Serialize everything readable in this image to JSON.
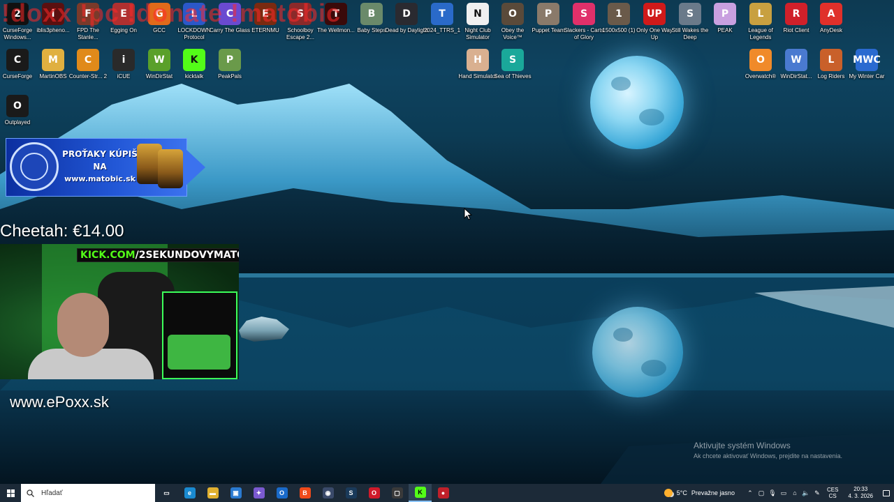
{
  "overlay": {
    "red_text": "!doxx !pc !donate !matobic"
  },
  "desktop_icons": [
    {
      "label": "CurseForge Windows...",
      "glyph": "2",
      "color": "#111111"
    },
    {
      "label": "iblis3pheno...",
      "glyph": "i",
      "color": "#5a1010"
    },
    {
      "label": "FPD The Stanle...",
      "glyph": "F",
      "color": "#7a3a2a"
    },
    {
      "label": "Egging On",
      "glyph": "E",
      "color": "#b03030"
    },
    {
      "label": "GCC",
      "glyph": "G",
      "color": "#e06a1a"
    },
    {
      "label": "LOCKDOWN Protocol",
      "glyph": "L",
      "color": "#2b58c9"
    },
    {
      "label": "Carry The Glass",
      "glyph": "C",
      "color": "#6a4ad0"
    },
    {
      "label": "ETERNMU",
      "glyph": "E",
      "color": "#7a2a10"
    },
    {
      "label": "Schoolboy Escape 2...",
      "glyph": "S",
      "color": "#8b2a2a"
    },
    {
      "label": "The Wellmon...",
      "glyph": "T",
      "color": "#3a0a0a"
    },
    {
      "label": "Baby Steps",
      "glyph": "B",
      "color": "#6a8a6a"
    },
    {
      "label": "Dead by Daylight",
      "glyph": "D",
      "color": "#2a2a30"
    },
    {
      "label": "2024_TTRS_1",
      "glyph": "T",
      "color": "#2a6ac9"
    },
    {
      "label": "Night Club Simulator",
      "glyph": "N",
      "color": "#f0f0f0"
    },
    {
      "label": "Obey the Voice™",
      "glyph": "O",
      "color": "#5a4a3a"
    },
    {
      "label": "Puppet Team",
      "glyph": "P",
      "color": "#8a7a6a"
    },
    {
      "label": "Slackers - Carts of Glory",
      "glyph": "S",
      "color": "#e0306a"
    },
    {
      "label": "1500x500 (1)",
      "glyph": "1",
      "color": "#6a5a4a"
    },
    {
      "label": "Only One Way Up",
      "glyph": "UP",
      "color": "#d01a1a"
    },
    {
      "label": "Still Wakes the Deep",
      "glyph": "S",
      "color": "#6a7a8a"
    },
    {
      "label": "PEAK",
      "glyph": "P",
      "color": "#c9a0e0"
    },
    {
      "label": "League of Legends",
      "glyph": "L",
      "color": "#c8a040"
    },
    {
      "label": "Riot Client",
      "glyph": "R",
      "color": "#d0202a"
    },
    {
      "label": "AnyDesk",
      "glyph": "A",
      "color": "#e0302a"
    },
    {
      "label": "CurseForge",
      "glyph": "C",
      "color": "#1a1a1a"
    },
    {
      "label": "MartinOBS",
      "glyph": "M",
      "color": "#e0b040"
    },
    {
      "label": "Counter-Str... 2",
      "glyph": "C",
      "color": "#e08a1a"
    },
    {
      "label": "iCUE",
      "glyph": "i",
      "color": "#2a2a2a"
    },
    {
      "label": "WinDirStat",
      "glyph": "W",
      "color": "#5aa02a"
    },
    {
      "label": "kicktalk",
      "glyph": "K",
      "color": "#53fc18"
    },
    {
      "label": "PeakPals",
      "glyph": "P",
      "color": "#6a9a4a"
    },
    {
      "label": "Hand Simulator",
      "glyph": "H",
      "color": "#d9b090"
    },
    {
      "label": "Sea of Thieves",
      "glyph": "S",
      "color": "#1aa89a"
    },
    {
      "label": "Overwatch®",
      "glyph": "O",
      "color": "#f08a2a"
    },
    {
      "label": "WinDirStat...",
      "glyph": "W",
      "color": "#4a7ad0"
    },
    {
      "label": "Log Riders",
      "glyph": "L",
      "color": "#c9602a"
    },
    {
      "label": "My Winter Car",
      "glyph": "MWC",
      "color": "#2a6ad0"
    },
    {
      "label": "Outplayed",
      "glyph": "O",
      "color": "#1a1a1a"
    }
  ],
  "promo": {
    "line1": "PROŤAKY KÚPIŠ",
    "line2": "NA",
    "line3": "www.matobic.sk"
  },
  "stream": {
    "donation": "Cheetah: €14.00",
    "kick_prefix": "KICK.COM",
    "kick_suffix": "/2SEKUNDOVYMATO",
    "website": "www.ePoxx.sk"
  },
  "activation": {
    "title": "Aktivujte systém Windows",
    "subtitle": "Ak chcete aktivovať Windows, prejdite na nastavenia."
  },
  "taskbar": {
    "search_placeholder": "Hľadať",
    "pinned": [
      {
        "name": "task-view-icon",
        "glyph": "▭",
        "color": "transparent"
      },
      {
        "name": "edge-icon",
        "glyph": "e",
        "color": "#1a8ad0"
      },
      {
        "name": "file-explorer-icon",
        "glyph": "▬",
        "color": "#e0b030"
      },
      {
        "name": "store-icon",
        "glyph": "▣",
        "color": "#2a7ad0"
      },
      {
        "name": "copilot-icon",
        "glyph": "✦",
        "color": "#7a5ad0"
      },
      {
        "name": "outlook-icon",
        "glyph": "O",
        "color": "#1a6ac9"
      },
      {
        "name": "brave-icon",
        "glyph": "B",
        "color": "#f04a1a"
      },
      {
        "name": "obs-icon",
        "glyph": "◉",
        "color": "#3a4a6a"
      },
      {
        "name": "steam-icon",
        "glyph": "S",
        "color": "#1a3a5a"
      },
      {
        "name": "opera-icon",
        "glyph": "O",
        "color": "#d01a2a"
      },
      {
        "name": "capture-icon",
        "glyph": "▢",
        "color": "#3a3a3a"
      },
      {
        "name": "kick-icon",
        "glyph": "K",
        "color": "#53fc18"
      },
      {
        "name": "record-icon",
        "glyph": "●",
        "color": "#c0202a"
      }
    ],
    "active_index": 11,
    "weather_temp": "5°C",
    "weather_text": "Prevažne jasno",
    "lang_top": "CES",
    "lang_bottom": "CS",
    "time": "20:33",
    "date": "4. 3. 2026"
  },
  "colors": {
    "taskbar_bg": "#1c2a38",
    "kick_green": "#53fc18"
  }
}
